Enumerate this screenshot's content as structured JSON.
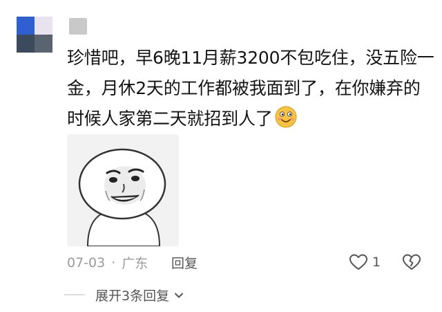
{
  "comment": {
    "lines": [
      "珍惜吧，早6晚11月薪3200不包吃住，没五险一",
      "金，月休2天的工作都被我面到了，在你嫌弃的",
      "时候人家第二天就招到人了"
    ],
    "emoji": "smile-emoji",
    "date": "07-03",
    "separator": "·",
    "location": "广东",
    "reply_label": "回复",
    "like_count": "1",
    "expand_label": "展开3条回复"
  },
  "icons": {
    "like": "heart-icon",
    "dislike": "broken-heart-icon",
    "expand": "chevron-down-icon"
  },
  "colors": {
    "text": "#141414",
    "meta": "#9a9a9a",
    "action": "#555555",
    "emoji_face": "#f6c343"
  }
}
